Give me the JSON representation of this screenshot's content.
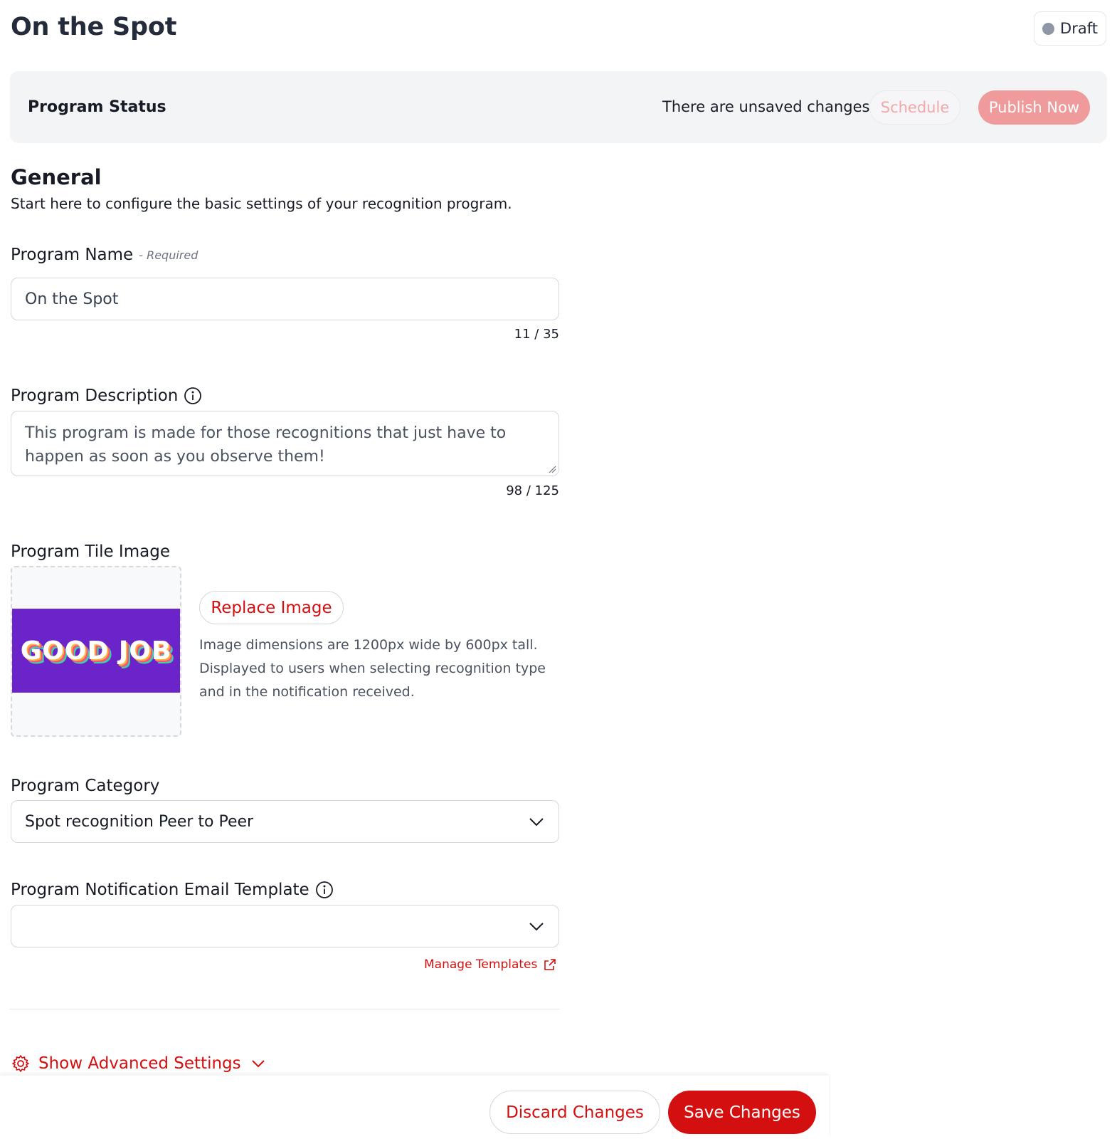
{
  "header": {
    "title": "On the Spot",
    "status_badge": "Draft"
  },
  "status_bar": {
    "label": "Program Status",
    "message": "There are unsaved changes",
    "schedule_label": "Schedule",
    "publish_label": "Publish Now"
  },
  "general": {
    "title": "General",
    "subtitle": "Start here to configure the basic settings of your recognition program."
  },
  "program_name": {
    "label": "Program Name",
    "required_tag": "- Required",
    "value": "On the Spot",
    "counter": "11 / 35"
  },
  "program_description": {
    "label": "Program Description",
    "value": "This program is made for those recognitions that just have to happen as soon as you observe them!",
    "counter": "98 / 125"
  },
  "tile_image": {
    "label": "Program Tile Image",
    "image_text": "GOOD JOB",
    "replace_label": "Replace Image",
    "help_line1": "Image dimensions are 1200px wide by 600px tall.",
    "help_line2": "Displayed to users when selecting recognition type",
    "help_line3": "and in the notification received."
  },
  "program_category": {
    "label": "Program Category",
    "selected": "Spot recognition Peer to Peer"
  },
  "email_template": {
    "label": "Program Notification Email Template",
    "selected": "",
    "manage_link": "Manage Templates"
  },
  "advanced": {
    "label": "Show Advanced Settings"
  },
  "footer": {
    "discard_label": "Discard Changes",
    "save_label": "Save Changes"
  },
  "colors": {
    "accent": "#d40f0f",
    "publish_disabled": "#ef9b9b",
    "tile_background": "#6b24c9",
    "status_bar_bg": "#f3f4f6"
  },
  "icons": {
    "status_dot": "gray-dot-icon",
    "info": "info-icon",
    "chevron": "chevron-down-icon",
    "external": "external-link-icon",
    "gear": "gear-icon"
  }
}
